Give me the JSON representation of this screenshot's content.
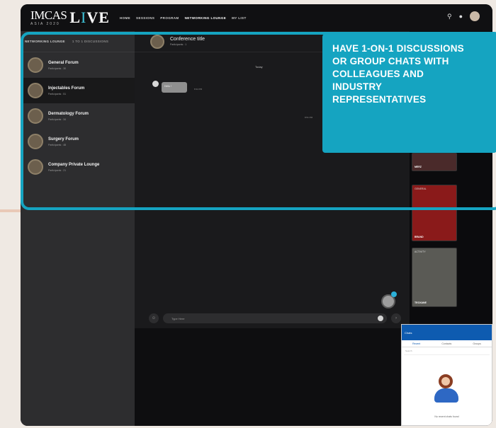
{
  "brand": {
    "logo_text": "IMCAS",
    "logo_sub": "ASIA 2020",
    "live_pre": "L",
    "live_accent": "I",
    "live_post": "VE"
  },
  "nav": {
    "items": [
      "HOME",
      "SESSIONS",
      "PROGRAM",
      "NETWORKING LOUNGE",
      "MY LIST"
    ],
    "active_index": 3
  },
  "sidebar": {
    "tabs": [
      "NETWORKING LOUNGE",
      "1 TO 1 DISCUSSIONS"
    ],
    "forums": [
      {
        "name": "General Forum",
        "participants": "Participants : 30"
      },
      {
        "name": "Injectables Forum",
        "participants": "Participants : 51"
      },
      {
        "name": "Dermatology Forum",
        "participants": "Participants : 34"
      },
      {
        "name": "Surgery Forum",
        "participants": "Participants : 48"
      },
      {
        "name": "Company Private Lounge",
        "participants": "Participants : 21"
      }
    ],
    "selected_index": 1
  },
  "chat": {
    "title": "Conference title",
    "subtitle": "Participants : 1",
    "date_separator": "Today",
    "message_text": "Hello !",
    "message_time": "8:34 PM",
    "message_time_2": "8:51 PM",
    "input_placeholder": "Type Here",
    "emoji_button": "☺",
    "send_button": "›"
  },
  "right_tiles": [
    {
      "top_label": "",
      "bottom_label": "MERZ",
      "color": "#4a2a2a"
    },
    {
      "top_label": "GENERAL",
      "bottom_label": "BRAND",
      "color": "#8a1a1a"
    },
    {
      "top_label": "ACTIVITY",
      "bottom_label": "TEOXANE",
      "color": "#5a5a55"
    }
  ],
  "panel": {
    "header": "Chats",
    "tabs": [
      "Recent",
      "Contacts",
      "Groups"
    ],
    "search_placeholder": "Search",
    "caption": "No recent chats found"
  },
  "callout": {
    "text": "HAVE 1-ON-1 DISCUSSIONS OR GROUP CHATS WITH COLLEAGUES AND INDUSTRY REPRESENTATIVES"
  },
  "colors": {
    "accent": "#15a4c1",
    "panel_head": "#0e5bb0"
  }
}
